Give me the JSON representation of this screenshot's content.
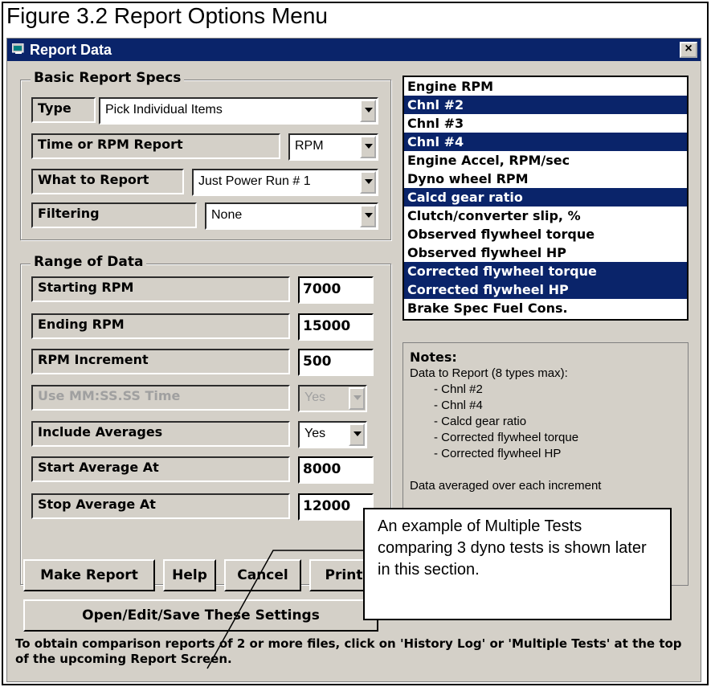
{
  "figure_caption": "Figure 3.2  Report Options Menu",
  "window": {
    "title": "Report Data",
    "close_label": "×"
  },
  "basic_specs": {
    "legend": "Basic Report Specs",
    "type_label": "Type",
    "type_value": "Pick Individual Items",
    "time_rpm_label": "Time or RPM Report",
    "time_rpm_value": "RPM",
    "what_label": "What to Report",
    "what_value": "Just Power Run # 1",
    "filter_label": "Filtering",
    "filter_value": "None"
  },
  "range": {
    "legend": "Range of Data",
    "starting_label": "Starting RPM",
    "starting_value": "7000",
    "ending_label": "Ending RPM",
    "ending_value": "15000",
    "increment_label": "RPM Increment",
    "increment_value": "500",
    "mmss_label": "Use MM:SS.SS Time",
    "mmss_value": "Yes",
    "averages_label": "Include Averages",
    "averages_value": "Yes",
    "start_avg_label": "Start Average At",
    "start_avg_value": "8000",
    "stop_avg_label": "Stop Average At",
    "stop_avg_value": "12000"
  },
  "data_items": [
    {
      "label": "Engine RPM",
      "selected": false
    },
    {
      "label": "Chnl #2",
      "selected": true
    },
    {
      "label": "Chnl #3",
      "selected": false
    },
    {
      "label": "Chnl #4",
      "selected": true
    },
    {
      "label": "Engine Accel, RPM/sec",
      "selected": false
    },
    {
      "label": "Dyno wheel RPM",
      "selected": false
    },
    {
      "label": "Calcd gear ratio",
      "selected": true
    },
    {
      "label": "Clutch/converter slip, %",
      "selected": false
    },
    {
      "label": "Observed flywheel torque",
      "selected": false
    },
    {
      "label": "Observed flywheel HP",
      "selected": false
    },
    {
      "label": "Corrected flywheel torque",
      "selected": true
    },
    {
      "label": "Corrected flywheel HP",
      "selected": true
    },
    {
      "label": "Brake Spec Fuel Cons.",
      "selected": false
    }
  ],
  "notes": {
    "title": "Notes:",
    "line0": "Data to Report (8 types max):",
    "items": [
      "- Chnl #2",
      "- Chnl #4",
      "- Calcd gear ratio",
      "- Corrected flywheel torque",
      "- Corrected flywheel HP"
    ],
    "line_partial": "Data averaged over each increment"
  },
  "buttons": {
    "make_report": "Make Report",
    "help": "Help",
    "cancel": "Cancel",
    "print": "Print",
    "open_edit_save": "Open/Edit/Save These Settings"
  },
  "footer": "To obtain comparison reports of 2 or more files, click on 'History Log' or 'Multiple Tests' at the top of the upcoming Report Screen.",
  "callout": "An example of Multiple Tests comparing 3 dyno tests is shown later in this section.",
  "colors": {
    "titlebar": "#0a246a",
    "selection": "#0a246a",
    "dialog_bg": "#d4d0c8"
  }
}
